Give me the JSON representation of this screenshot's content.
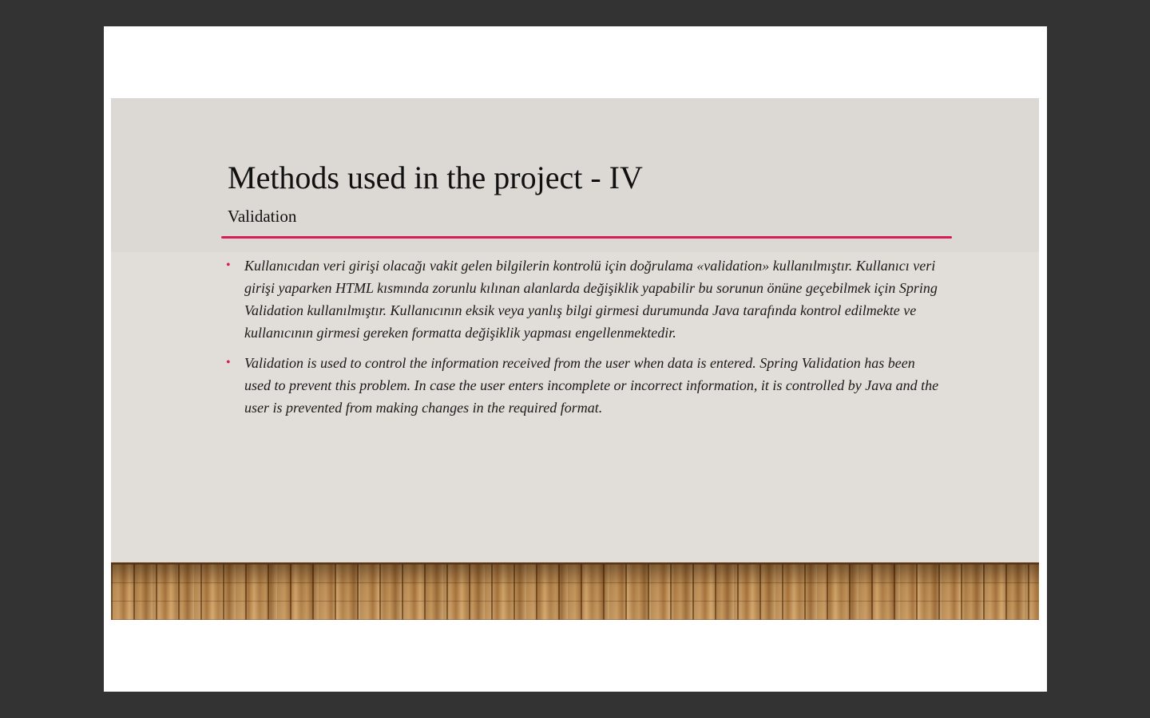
{
  "slide": {
    "title": "Methods used in the project - IV",
    "subtitle": "Validation",
    "accent_color": "#d81b55",
    "bullet_symbol": "•",
    "bullets": [
      {
        "text": "Kullanıcıdan veri girişi olacağı vakit gelen bilgilerin kontrolü için doğrulama «validation» kullanılmıştır. Kullanıcı veri girişi yaparken HTML kısmında zorunlu kılınan alanlarda değişiklik yapabilir bu sorunun önüne geçebilmek için Spring Validation kullanılmıştır. Kullanıcının eksik veya yanlış bilgi girmesi durumunda Java tarafında kontrol edilmekte ve kullanıcının girmesi gereken formatta değişiklik yapması engellenmektedir."
      },
      {
        "text": "Validation is used to control the information received from the user when data is entered. Spring Validation has been used to prevent this problem. In case the user enters incomplete or incorrect information, it is controlled by Java and the user is prevented from making changes in the required format."
      }
    ]
  }
}
